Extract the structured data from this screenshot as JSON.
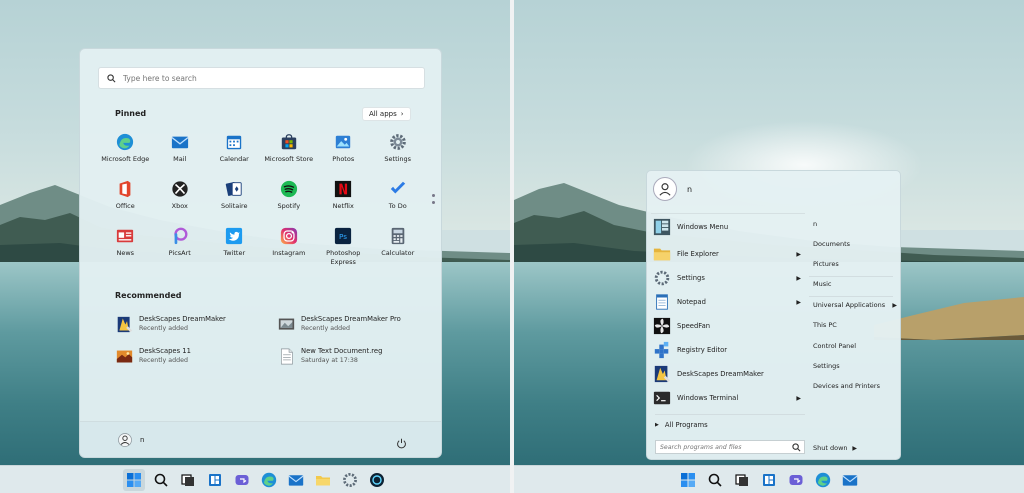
{
  "start11": {
    "search_placeholder": "Type here to search",
    "pinned_title": "Pinned",
    "all_apps_label": "All apps",
    "pinned": [
      {
        "label": "Microsoft Edge",
        "icon": "edge-icon"
      },
      {
        "label": "Mail",
        "icon": "mail-icon"
      },
      {
        "label": "Calendar",
        "icon": "calendar-icon"
      },
      {
        "label": "Microsoft Store",
        "icon": "store-icon"
      },
      {
        "label": "Photos",
        "icon": "photos-icon"
      },
      {
        "label": "Settings",
        "icon": "gear-icon"
      },
      {
        "label": "Office",
        "icon": "office-icon"
      },
      {
        "label": "Xbox",
        "icon": "xbox-icon"
      },
      {
        "label": "Solitaire",
        "icon": "cards-icon"
      },
      {
        "label": "Spotify",
        "icon": "spotify-icon"
      },
      {
        "label": "Netflix",
        "icon": "netflix-icon"
      },
      {
        "label": "To Do",
        "icon": "checkmark-icon"
      },
      {
        "label": "News",
        "icon": "news-icon"
      },
      {
        "label": "PicsArt",
        "icon": "picsart-icon"
      },
      {
        "label": "Twitter",
        "icon": "twitter-icon"
      },
      {
        "label": "Instagram",
        "icon": "instagram-icon"
      },
      {
        "label": "Photoshop Express",
        "icon": "photoshop-icon"
      },
      {
        "label": "Calculator",
        "icon": "calculator-icon"
      }
    ],
    "recommended_title": "Recommended",
    "recommended": [
      {
        "name": "DeskScapes DreamMaker",
        "sub": "Recently added"
      },
      {
        "name": "DeskScapes DreamMaker Pro",
        "sub": "Recently added"
      },
      {
        "name": "DeskScapes 11",
        "sub": "Recently added"
      },
      {
        "name": "New Text Document.reg",
        "sub": "Saturday at 17:38"
      }
    ],
    "user_name": "n"
  },
  "classic": {
    "user_name": "n",
    "programs": [
      {
        "label": "Windows Menu",
        "submenu": false
      },
      {
        "label": "File Explorer",
        "submenu": true
      },
      {
        "label": "Settings",
        "submenu": true
      },
      {
        "label": "Notepad",
        "submenu": true
      },
      {
        "label": "SpeedFan",
        "submenu": false
      },
      {
        "label": "Registry Editor",
        "submenu": false
      },
      {
        "label": "DeskScapes DreamMaker",
        "submenu": false
      },
      {
        "label": "Windows Terminal",
        "submenu": true
      }
    ],
    "all_programs_label": "All Programs",
    "search_placeholder": "Search programs and files",
    "right_items": [
      {
        "label": "n",
        "submenu": false
      },
      {
        "label": "Documents",
        "submenu": false
      },
      {
        "label": "Pictures",
        "submenu": false
      },
      {
        "label": "Music",
        "submenu": false
      },
      {
        "label": "Universal Applications",
        "submenu": true
      },
      {
        "label": "This PC",
        "submenu": false
      },
      {
        "label": "Control Panel",
        "submenu": false
      },
      {
        "label": "Settings",
        "submenu": false
      },
      {
        "label": "Devices and Printers",
        "submenu": false
      }
    ],
    "shutdown_label": "Shut down"
  },
  "colors": {
    "accent": "#0078d4",
    "panel": "#e2f0f2"
  }
}
